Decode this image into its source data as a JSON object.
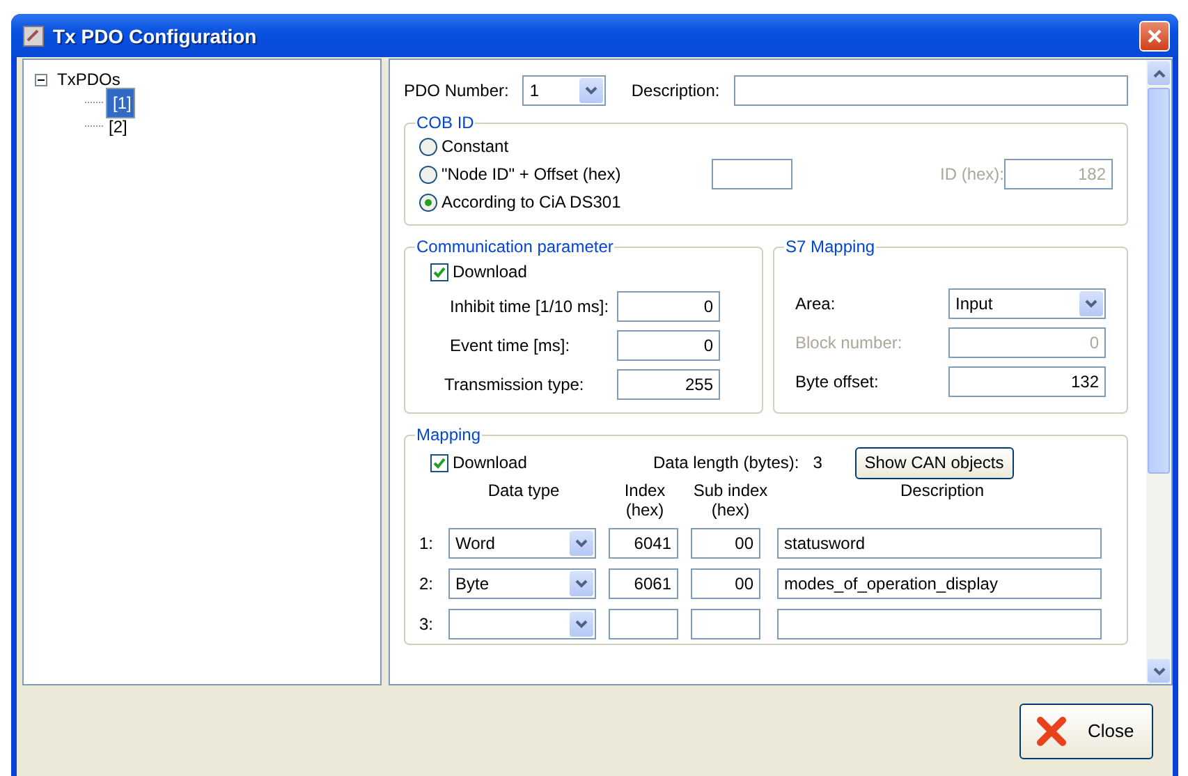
{
  "window": {
    "title": "Tx PDO Configuration"
  },
  "tree": {
    "label": "TxPDOs",
    "expanded": true,
    "children": [
      {
        "label": "[1]",
        "selected": true
      },
      {
        "label": "[2]",
        "selected": false
      }
    ]
  },
  "pdo_number": {
    "label": "PDO Number:",
    "value": "1"
  },
  "description": {
    "label": "Description:"
  },
  "cob_id": {
    "title": "COB ID",
    "options": [
      {
        "label": "Constant",
        "selected": false
      },
      {
        "label": "\"Node ID\" + Offset (hex)",
        "selected": false
      },
      {
        "label": "According to CiA DS301",
        "selected": true
      }
    ],
    "id_hex": {
      "label": "ID (hex):",
      "value": "182",
      "disabled": true
    }
  },
  "communication": {
    "title": "Communication parameter",
    "download": {
      "label": "Download",
      "checked": true
    },
    "fields": [
      {
        "label": "Inhibit time [1/10 ms]:",
        "value": "0"
      },
      {
        "label": "Event time [ms]:",
        "value": "0"
      },
      {
        "label": "Transmission type:",
        "value": "255"
      }
    ]
  },
  "s7_mapping": {
    "title": "S7 Mapping",
    "fields": [
      {
        "kind": "dropdown",
        "label": "Area:",
        "value": "Input",
        "disabled": false
      },
      {
        "kind": "text",
        "label": "Block number:",
        "value": "0",
        "disabled": true
      },
      {
        "kind": "text",
        "label": "Byte offset:",
        "value": "132",
        "disabled": false
      }
    ]
  },
  "mapping": {
    "title": "Mapping",
    "download": {
      "label": "Download",
      "checked": true
    },
    "data_length_label": "Data length (bytes):",
    "data_length": "3",
    "button": "Show CAN objects",
    "columns": [
      "Data type",
      "Index\n(hex)",
      "Sub index\n(hex)",
      "Description"
    ],
    "rows": [
      {
        "number": "1:",
        "data_type": "Word",
        "index": "6041",
        "sub_index": "00",
        "description": "statusword"
      },
      {
        "number": "2:",
        "data_type": "Byte",
        "index": "6061",
        "sub_index": "00",
        "description": "modes_of_operation_display"
      },
      {
        "number": "3:"
      }
    ]
  },
  "close_button": "Close"
}
